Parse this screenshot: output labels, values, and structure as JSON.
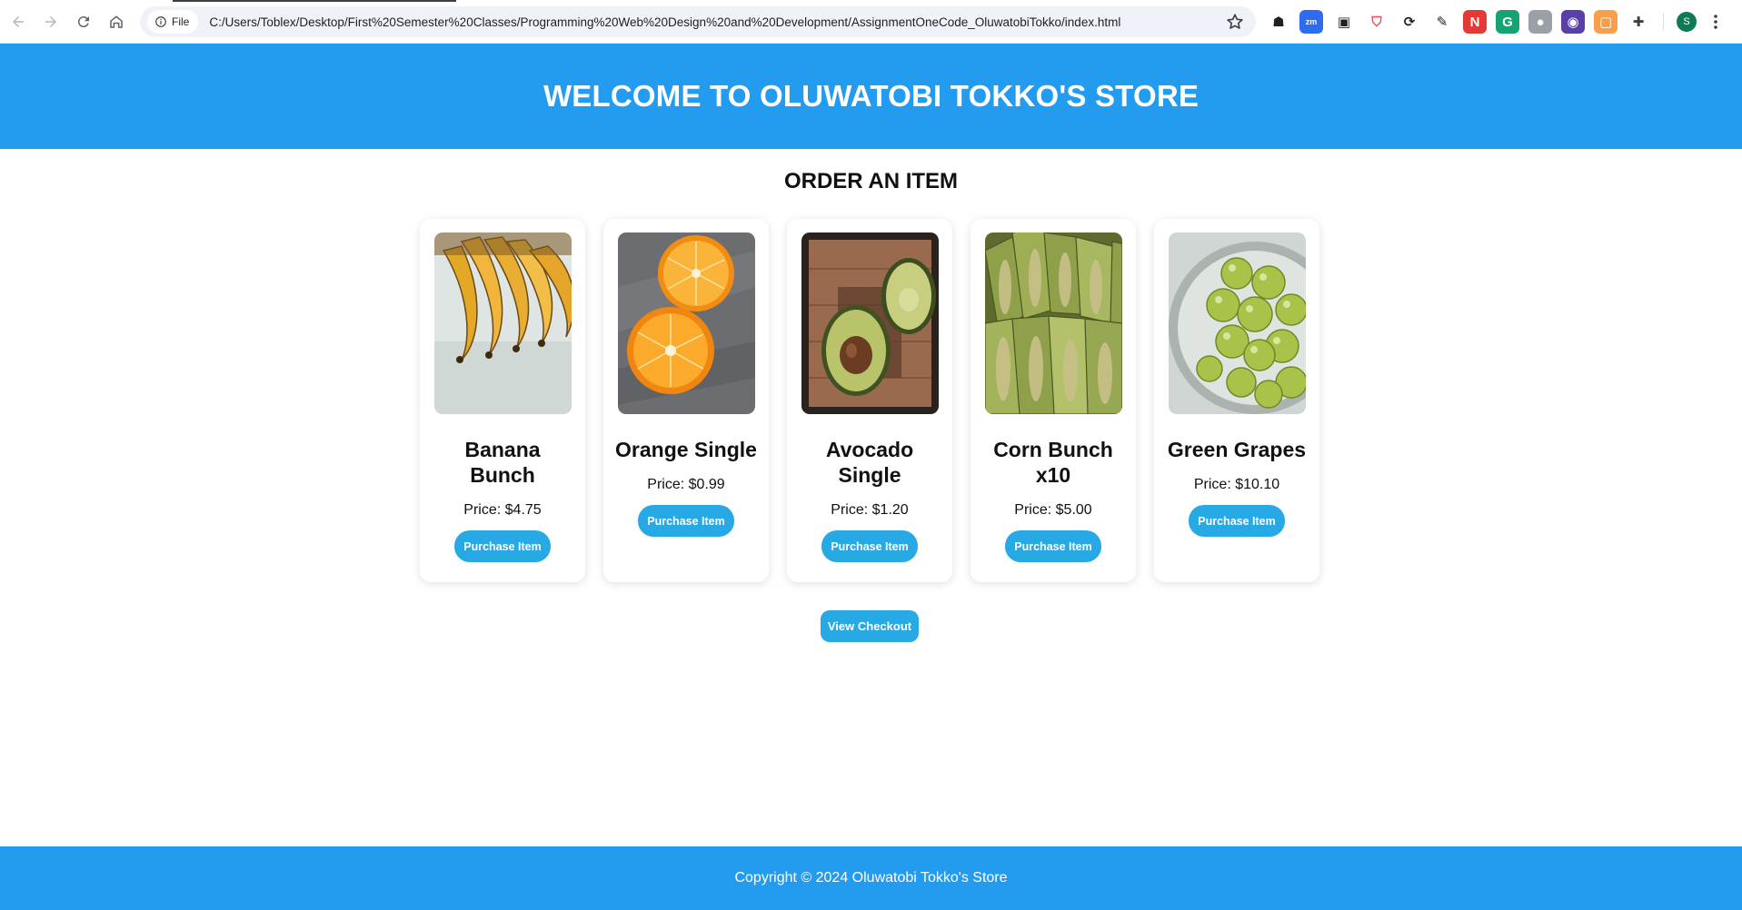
{
  "browser": {
    "site_chip_label": "File",
    "url": "C:/Users/Toblex/Desktop/First%20Semester%20Classes/Programming%20Web%20Design%20and%20Development/AssignmentOneCode_OluwatobiTokko/index.html",
    "profile_initial": "S",
    "extensions": [
      {
        "name": "ext-ghost-icon",
        "color": "#ffffff",
        "glyph": "☗",
        "fg": "#202124"
      },
      {
        "name": "ext-zoom-icon",
        "color": "#2d6cf0",
        "glyph": "zm",
        "fg": "#ffffff"
      },
      {
        "name": "ext-screen-icon",
        "color": "#ffffff",
        "glyph": "▣",
        "fg": "#202124"
      },
      {
        "name": "ext-shield-icon",
        "color": "#ffffff",
        "glyph": "⛉",
        "fg": "#e8505b"
      },
      {
        "name": "ext-sync-icon",
        "color": "#ffffff",
        "glyph": "⟳",
        "fg": "#202124"
      },
      {
        "name": "ext-pen-icon",
        "color": "#ffffff",
        "glyph": "✎",
        "fg": "#202124"
      },
      {
        "name": "ext-n-icon",
        "color": "#e53935",
        "glyph": "N",
        "fg": "#ffffff"
      },
      {
        "name": "ext-grammarly-icon",
        "color": "#15a374",
        "glyph": "G",
        "fg": "#ffffff"
      },
      {
        "name": "ext-user-icon",
        "color": "#9aa0a6",
        "glyph": "●",
        "fg": "#ffffff"
      },
      {
        "name": "ext-circle-icon",
        "color": "#5b3fa8",
        "glyph": "◉",
        "fg": "#ffffff"
      },
      {
        "name": "ext-box-icon",
        "color": "#f6a04d",
        "glyph": "▢",
        "fg": "#ffffff"
      },
      {
        "name": "extensions-puzzle-icon",
        "color": "#ffffff",
        "glyph": "✚",
        "fg": "#3c4043"
      }
    ]
  },
  "header": {
    "title": "WELCOME TO OLUWATOBI TOKKO'S STORE"
  },
  "main": {
    "section_title": "ORDER AN ITEM",
    "products": [
      {
        "name": "Banana Bunch",
        "price": "Price: $4.75",
        "button": "Purchase Item",
        "image": "banana"
      },
      {
        "name": "Orange Single",
        "price": "Price: $0.99",
        "button": "Purchase Item",
        "image": "orange"
      },
      {
        "name": "Avocado Single",
        "price": "Price: $1.20",
        "button": "Purchase Item",
        "image": "avocado"
      },
      {
        "name": "Corn Bunch x10",
        "price": "Price: $5.00",
        "button": "Purchase Item",
        "image": "corn"
      },
      {
        "name": "Green Grapes",
        "price": "Price: $10.10",
        "button": "Purchase Item",
        "image": "grapes"
      }
    ],
    "checkout_button": "View Checkout"
  },
  "footer": {
    "copyright": "Copyright © 2024 Oluwatobi Tokko's Store"
  },
  "colors": {
    "brand_blue": "#239bef",
    "button_blue": "#27a9e6"
  }
}
